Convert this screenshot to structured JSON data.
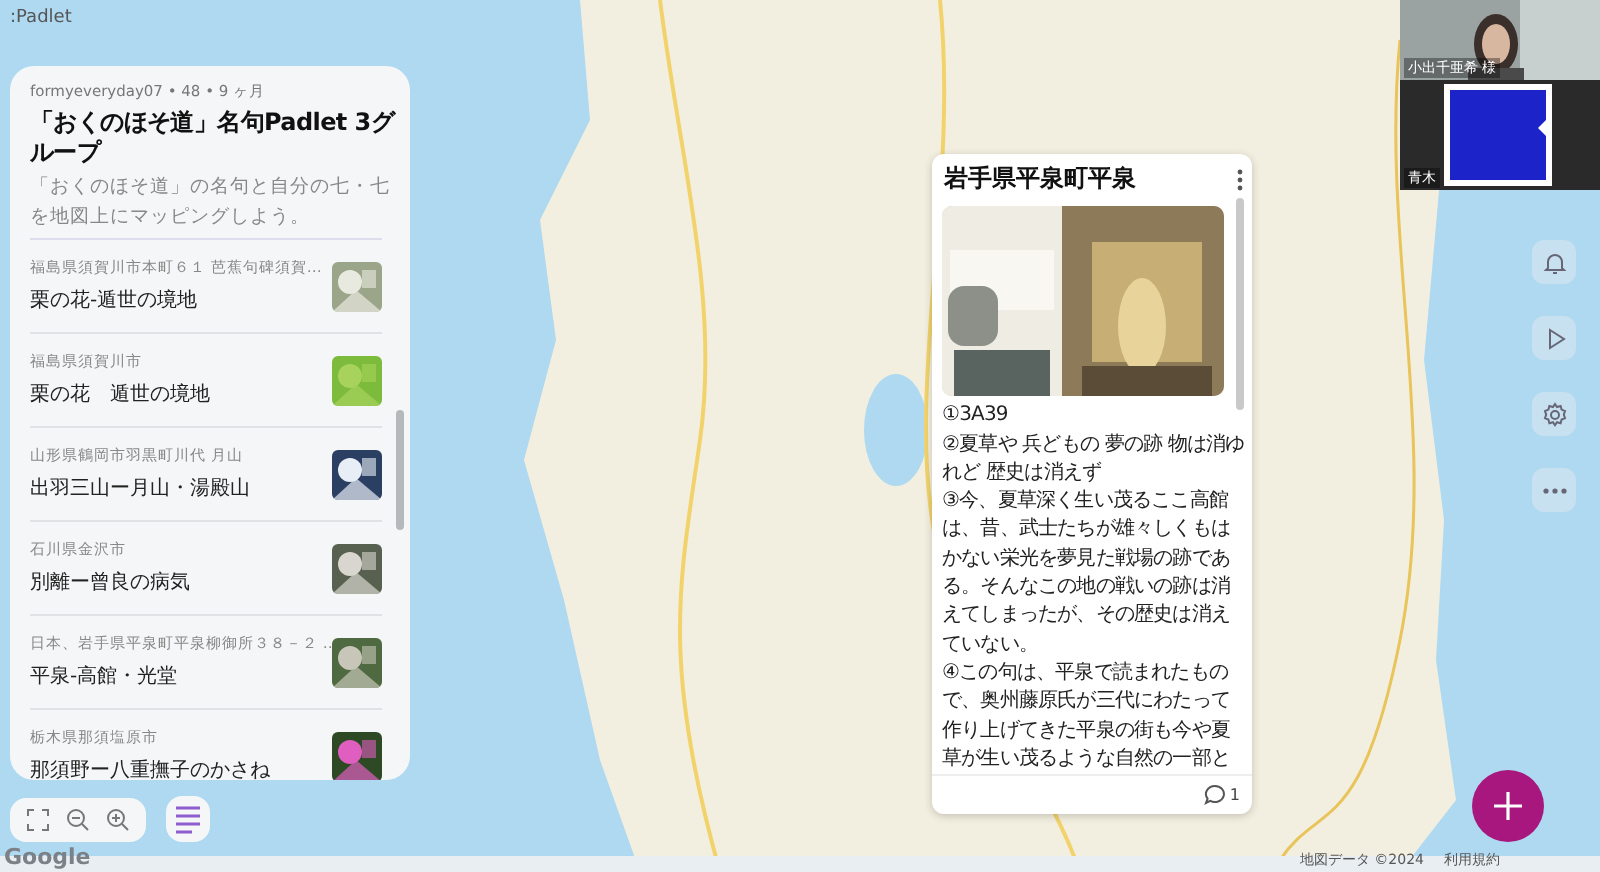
{
  "app": {
    "logo": ":Padlet"
  },
  "board": {
    "meta": "formyeveryday07 • 48 • 9 ヶ月",
    "title": "「おくのほそ道」名句Padlet 3グループ",
    "description": "「おくのほそ道」の名句と自分の七・七を地図上にマッピングしよう。",
    "posts": [
      {
        "address": "福島県須賀川市本町６１ 芭蕉句碑須賀…",
        "title": "栗の花-遁世の境地"
      },
      {
        "address": "福島県須賀川市",
        "title": "栗の花　遁世の境地"
      },
      {
        "address": "山形県鶴岡市羽黒町川代 月山",
        "title": "出羽三山ー月山・湯殿山"
      },
      {
        "address": "石川県金沢市",
        "title": "別離ー曾良の病気"
      },
      {
        "address": "日本、岩手県平泉町平泉柳御所３８－２ …",
        "title": "平泉-高館・光堂"
      },
      {
        "address": "栃木県那須塩原市",
        "title": "那須野ー八重撫子のかさね"
      }
    ]
  },
  "post_card": {
    "title": "岩手県平泉町平泉",
    "paragraphs": [
      "①3A39",
      "②夏草や 兵どもの 夢の跡 物は消ゆれど 歴史は消えず",
      "③今、夏草深く生い茂るここ高館は、昔、武士たちが雄々しくもはかない栄光を夢見た戦場の跡である。そんなこの地の戦いの跡は消えてしまったが、その歴史は消えていない。",
      "④この句は、平泉で読まれたもので、奥州藤原氏が三代にわたって作り上げてきた平泉の街も今や夏草が生い茂るような自然の一部と"
    ],
    "comment_count": "1"
  },
  "video_call": {
    "participants": [
      {
        "name": "小出千亜希 様",
        "kind": "camera"
      },
      {
        "name": "青木",
        "kind": "logo"
      }
    ]
  },
  "map_attribution": {
    "provider": "Google",
    "data": "地図データ ©2024",
    "terms": "利用規約"
  }
}
